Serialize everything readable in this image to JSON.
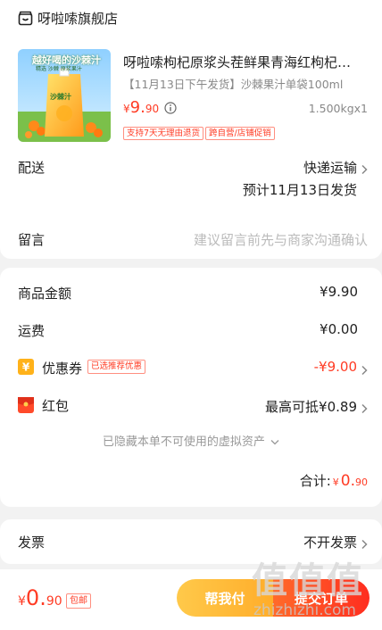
{
  "shop": {
    "name": "呀啦嗦旗舰店",
    "icon": "shop-icon"
  },
  "product": {
    "title": "呀啦嗦枸杞原浆头茬鲜果青海红枸杞…",
    "spec": "【11月13日下午发货】沙棘果汁单袋100ml",
    "price_yen": "¥",
    "price_int": "9.",
    "price_dec": "90",
    "qty": "1.500kgx1",
    "tags": [
      "支持7天无理由退货",
      "跨自营/店铺促销"
    ],
    "thumb_text": "越好喝的沙棘汁",
    "thumb_sub": "精选 沙棘 原浆果汁",
    "thumb_pack": "沙棘汁"
  },
  "delivery": {
    "label": "配送",
    "method": "快递运输",
    "eta": "预计11月13日发货"
  },
  "message": {
    "label": "留言",
    "placeholder": "建议留言前先与商家沟通确认"
  },
  "summary": {
    "goods_label": "商品金额",
    "goods_value": "¥9.90",
    "shipping_label": "运费",
    "shipping_value": "¥0.00",
    "coupon_label": "优惠券",
    "coupon_tag": "已选推荐优惠",
    "coupon_value": "-¥9.00",
    "redpack_label": "红包",
    "redpack_value": "最高可抵¥0.89",
    "hidden_note": "已隐藏本单不可使用的虚拟资产",
    "total_label": "合计:",
    "total_yen": "¥",
    "total_int": "0.",
    "total_dec": "90"
  },
  "invoice": {
    "label": "发票",
    "value": "不开发票"
  },
  "bottom": {
    "price_yen": "¥",
    "price_int": "0.",
    "price_dec": "90",
    "shipping_tag": "包邮",
    "help_pay": "帮我付",
    "submit": "提交订单"
  },
  "watermark": {
    "text": "zhizhizhi.com",
    "glyphs": "值值值"
  },
  "colors": {
    "accent": "#ff3b24",
    "help_btn": "#ffb838",
    "submit_btn": "#ff3a20"
  }
}
